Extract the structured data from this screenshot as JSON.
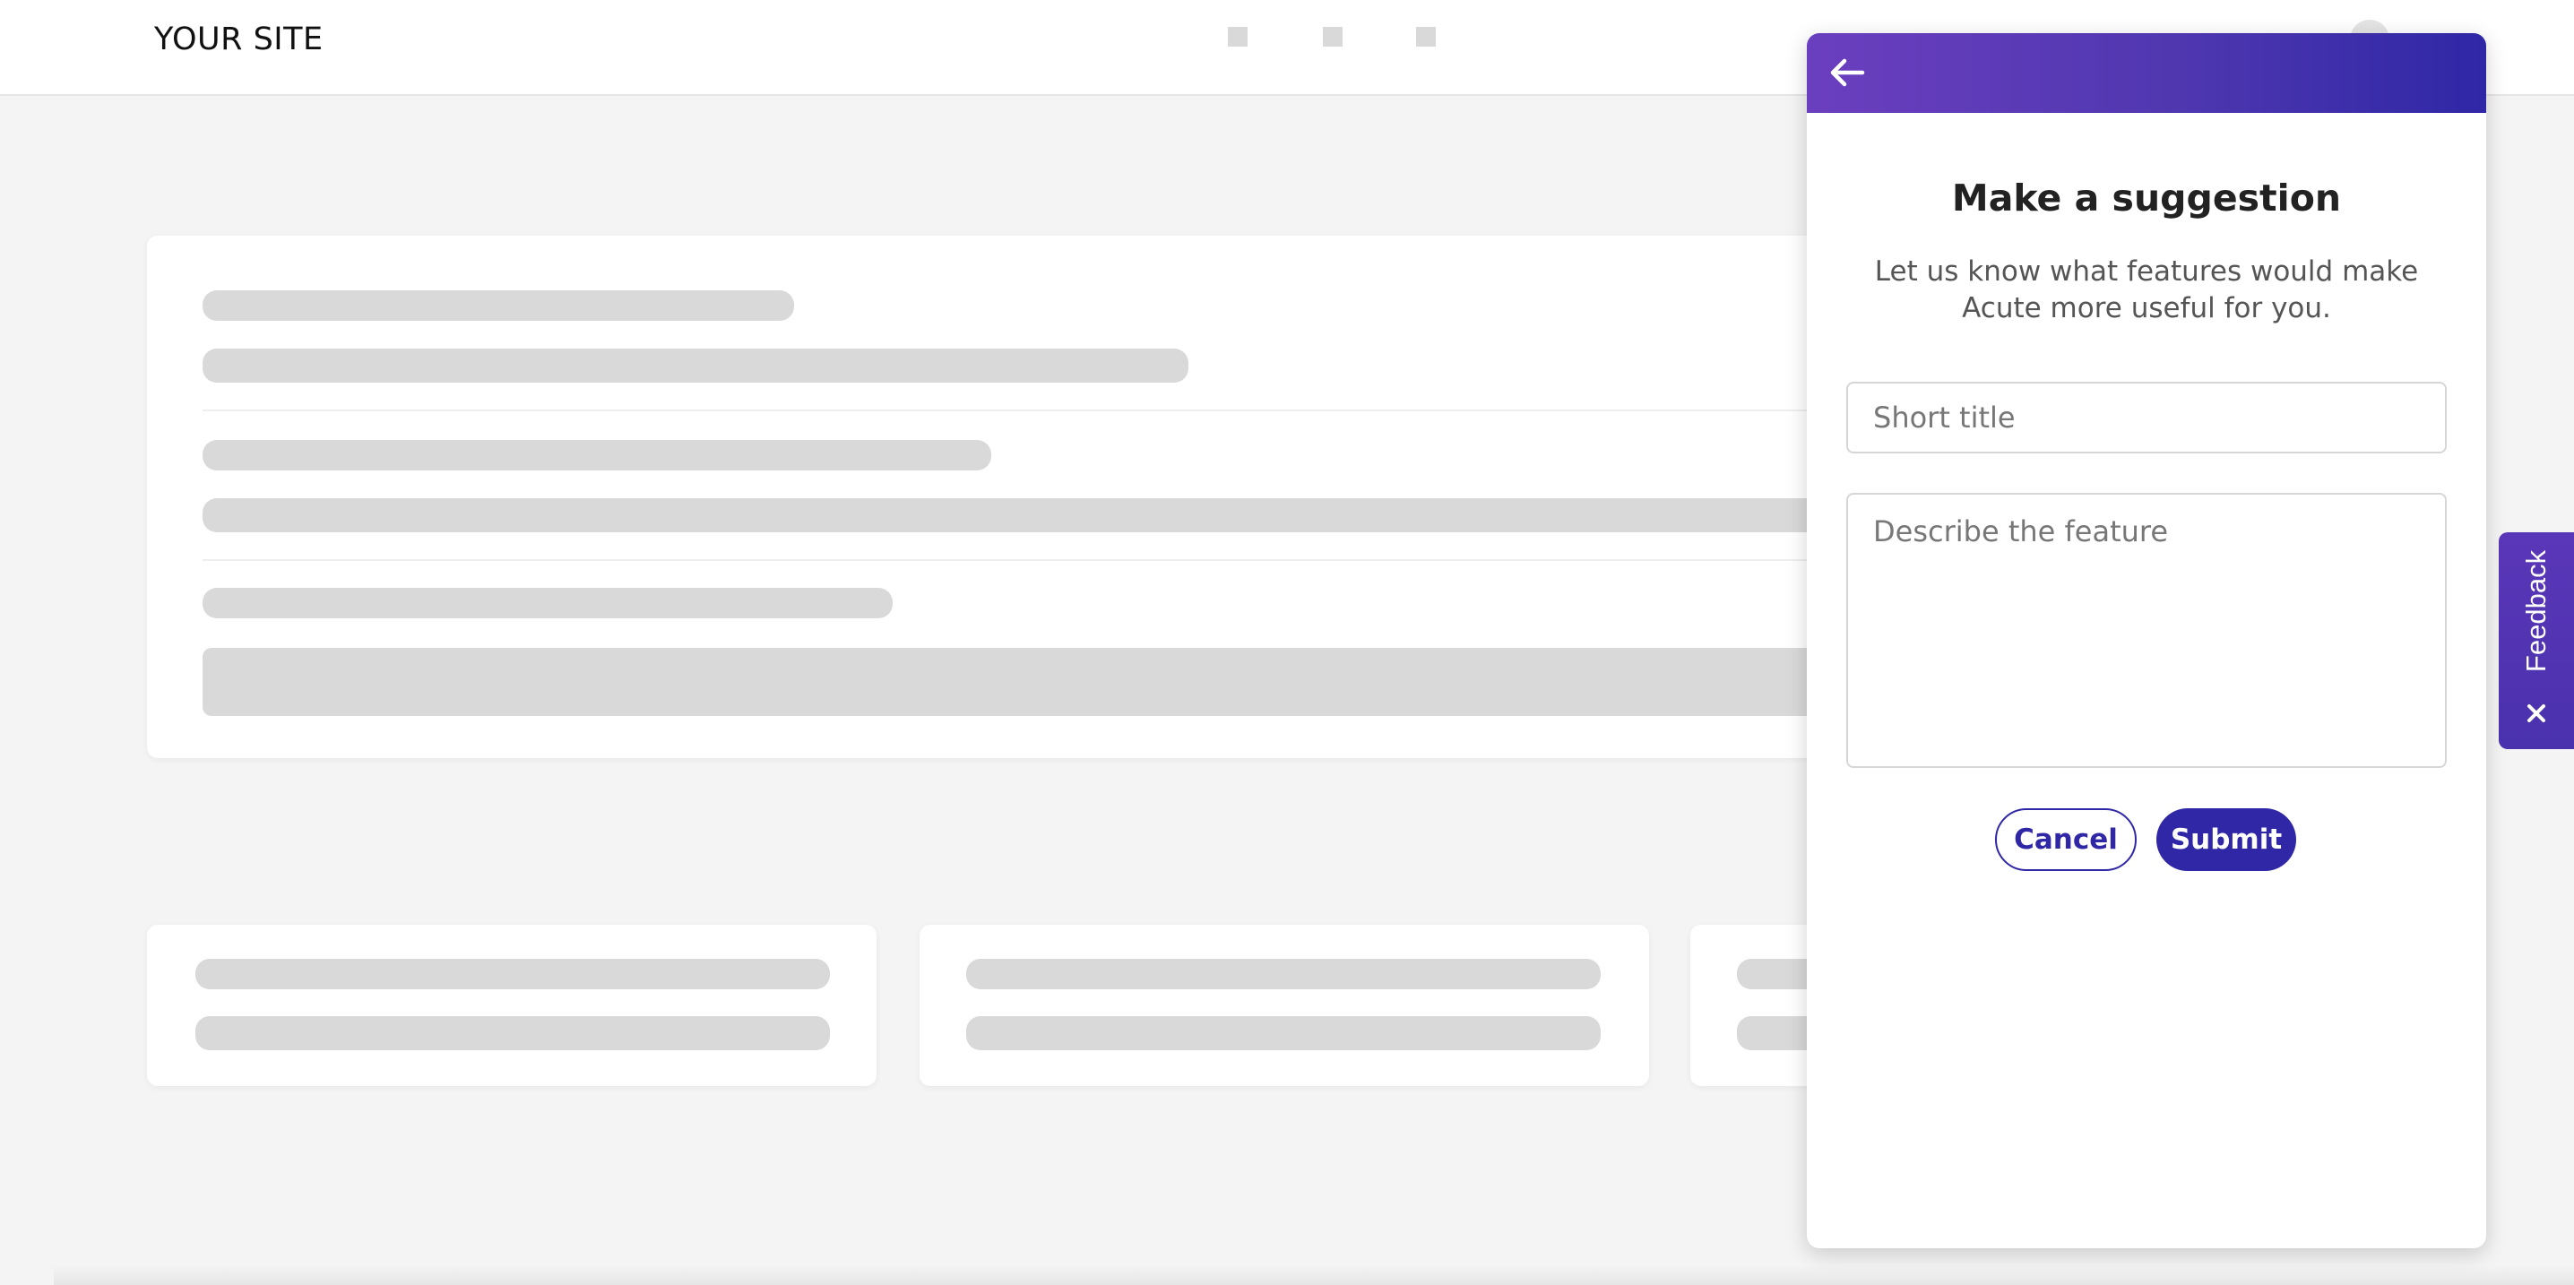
{
  "header": {
    "site_title": "YOUR SITE",
    "nav_items": [
      "nav-placeholder-1",
      "nav-placeholder-2",
      "nav-placeholder-3"
    ]
  },
  "widget": {
    "back_icon": "arrow-left-icon",
    "title": "Make a suggestion",
    "subtitle": "Let us know what features would make Acute more useful for you.",
    "title_input": {
      "placeholder": "Short title",
      "value": ""
    },
    "description_input": {
      "placeholder": "Describe the feature",
      "value": ""
    },
    "cancel_label": "Cancel",
    "submit_label": "Submit"
  },
  "feedback_tab": {
    "label": "Feedback",
    "close_icon": "close-icon"
  },
  "colors": {
    "accent": "#2f27a6",
    "header_gradient_start": "#6b3fbf",
    "header_gradient_end": "#2f27a6",
    "page_background": "#f4f4f4",
    "skeleton": "#d9d9d9"
  }
}
